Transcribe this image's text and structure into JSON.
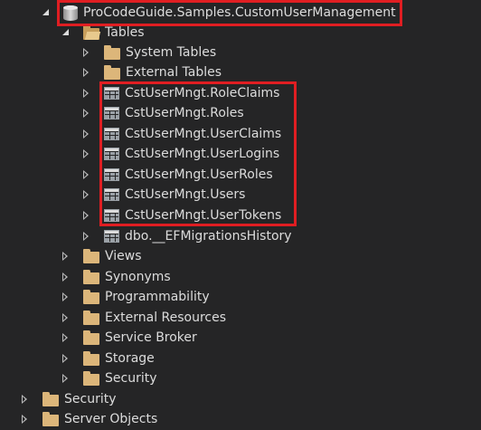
{
  "tree": {
    "database": "ProCodeGuide.Samples.CustomUserManagement",
    "tables_folder": "Tables",
    "system_tables": "System Tables",
    "external_tables": "External Tables",
    "tables": [
      "CstUserMngt.RoleClaims",
      "CstUserMngt.Roles",
      "CstUserMngt.UserClaims",
      "CstUserMngt.UserLogins",
      "CstUserMngt.UserRoles",
      "CstUserMngt.Users",
      "CstUserMngt.UserTokens"
    ],
    "migrations_table": "dbo.__EFMigrationsHistory",
    "db_folders": [
      "Views",
      "Synonyms",
      "Programmability",
      "External Resources",
      "Service Broker",
      "Storage",
      "Security"
    ],
    "server_folders": [
      "Security",
      "Server Objects"
    ]
  },
  "colors": {
    "background": "#252526",
    "text": "#dcdcdc",
    "folder": "#dcb67a",
    "highlight": "#e01e22"
  }
}
